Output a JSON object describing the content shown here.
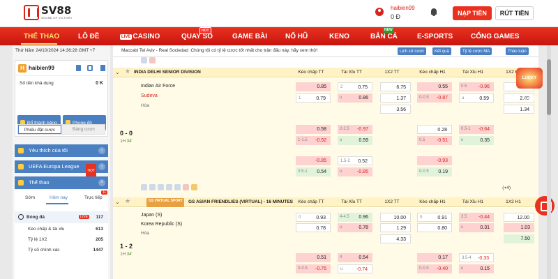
{
  "header": {
    "logo_name": "SV88",
    "logo_tagline": "SOUND OF VICTORY",
    "username": "haibien99",
    "balance": "0 Đ",
    "deposit_label": "NẠP TIỀN",
    "withdraw_label": "RÚT TIỀN"
  },
  "nav": {
    "items": [
      "THỂ THAO",
      "LÔ ĐỀ",
      "CASINO",
      "QUAY SỐ",
      "GAME BÀI",
      "NỔ HŨ",
      "KENO",
      "BẮN CÁ",
      "E-SPORTS",
      "CỔNG GAMES"
    ],
    "live_badge": "LIVE",
    "hot_badge": "HOT",
    "new_badge": "NEW"
  },
  "sidebar": {
    "datetime": "Thứ Năm 24/10/2024 14:36:28 GMT +7",
    "avatar_letter": "H",
    "username": "haibien99",
    "balance_label": "Số tiền khả dụng",
    "balance_value": "0 K",
    "btn_deposit": "Đổ thành bảng",
    "btn_promo": "Phong độ",
    "tab_active": "Phiếu đặt cược",
    "tab_other": "Bảng cược",
    "sections": [
      "Yêu thích của tôi",
      "UEFA Europa League",
      "Thể thao"
    ],
    "hot_badge": "HOT",
    "sub_tabs": [
      "Sớm",
      "Hôm nay",
      "Trực tiếp"
    ],
    "live_count": "11",
    "sport": {
      "name": "Bóng đá",
      "live": "LIVE",
      "count": "117"
    },
    "rows": [
      {
        "name": "Kèo chấp & tài xỉu",
        "count": "613"
      },
      {
        "name": "Tỷ lệ 1X2",
        "count": "205"
      },
      {
        "name": "Tỷ số chính xác",
        "count": "1447"
      }
    ]
  },
  "notice": {
    "text": "Maccabi Tel Aviv - Real Sociedad :Chúng tôi có tỷ lệ cược tốt nhất cho trận đấu này, hãy xem thử!",
    "btn_history": "Lịch sử cược",
    "btn_result": "Kết quả",
    "btn_odds": "Tỷ lệ cược MA",
    "btn_discuss": "Thảo luận"
  },
  "columns": [
    "Kèo chấp TT",
    "Tài Xỉu TT",
    "1X2 TT",
    "Kèo chấp H1",
    "Tài Xỉu H1",
    "1X2 H1"
  ],
  "league1": {
    "title": "INDIA DELHI SENIOR DIVISION",
    "score": "0 - 0",
    "time": "1H 34'",
    "home": "Indian Air Force",
    "away": "Sudeva",
    "draw": "Hòa",
    "more": "(+4)"
  },
  "league2": {
    "badge": "GS VIRTUAL SPORT",
    "title": "GS ASIAN FRIENDLIES (VIRTUAL) - 16 MINUTES",
    "score": "1 - 2",
    "time": "1H 34'",
    "home": "Japan (S)",
    "away": "Korea Republic (S)",
    "draw": "Hòa"
  },
  "odds_l1": {
    "r1": [
      [
        "",
        "0.85",
        "pk"
      ],
      [
        "2",
        "0.75",
        "wh"
      ],
      [
        "",
        "6.75",
        "wh"
      ],
      [
        "",
        "0.55",
        "pk"
      ],
      [
        "0.5",
        "-0.96",
        "pk"
      ],
      [
        "",
        "9.50",
        "wh"
      ]
    ],
    "r2": [
      [
        "1",
        "0.79",
        "wh"
      ],
      [
        "u",
        "0.86",
        "pk"
      ],
      [
        "",
        "1.37",
        "wh"
      ],
      [
        "0-0.5",
        "-0.87",
        "pk"
      ],
      [
        "u",
        "0.59",
        "wh"
      ],
      [
        "",
        "2.85",
        "wh"
      ]
    ],
    "r3": [
      [
        "",
        "",
        "none"
      ],
      [
        "",
        "",
        "none"
      ],
      [
        "",
        "3.56",
        "wh"
      ],
      [
        "",
        "",
        "none"
      ],
      [
        "",
        "",
        "none"
      ],
      [
        "",
        "1.34",
        "wh"
      ]
    ],
    "r4": [
      [
        "",
        "0.58",
        "pk"
      ],
      [
        "2-2.5",
        "-0.97",
        "pk"
      ],
      [
        "",
        "",
        "none"
      ],
      [
        "",
        "0.28",
        "wh"
      ],
      [
        "0.5-1",
        "-0.64",
        "pk"
      ],
      [
        "",
        "",
        "none"
      ]
    ],
    "r5": [
      [
        "1-1.5",
        "-0.92",
        "pk"
      ],
      [
        "u",
        "0.59",
        "gr"
      ],
      [
        "",
        "",
        "none"
      ],
      [
        "0.5",
        "-0.51",
        "pk"
      ],
      [
        "u",
        "0.35",
        "gr"
      ],
      [
        "",
        "",
        "none"
      ]
    ],
    "r6": [
      [
        "",
        "-0.85",
        "pk"
      ],
      [
        "1.5-2",
        "0.52",
        "wh"
      ],
      [
        "",
        "",
        "none"
      ],
      [
        "",
        "-0.93",
        "pk"
      ],
      [
        "",
        "",
        "none"
      ],
      [
        "",
        "",
        "none"
      ]
    ],
    "r7": [
      [
        "0.5-1",
        "0.54",
        "gr"
      ],
      [
        "u",
        "-0.85",
        "pk"
      ],
      [
        "",
        "",
        "none"
      ],
      [
        "0-0.5",
        "0.19",
        "gr"
      ],
      [
        "",
        "",
        "none"
      ],
      [
        "",
        "",
        "none"
      ]
    ]
  },
  "odds_l2": {
    "r1": [
      [
        "0",
        "0.93",
        "wh"
      ],
      [
        "4-4.5",
        "0.96",
        "gr"
      ],
      [
        "",
        "10.00",
        "wh"
      ],
      [
        "0",
        "0.91",
        "wh"
      ],
      [
        "3.5",
        "-0.44",
        "pk"
      ],
      [
        "",
        "12.00",
        "wh"
      ]
    ],
    "r2": [
      [
        "",
        "0.78",
        "wh"
      ],
      [
        "u",
        "0.78",
        "pk"
      ],
      [
        "",
        "1.29",
        "wh"
      ],
      [
        "",
        "0.80",
        "wh"
      ],
      [
        "u",
        "0.31",
        "pk"
      ],
      [
        "",
        "1.03",
        "pk"
      ]
    ],
    "r3": [
      [
        "",
        "",
        "none"
      ],
      [
        "",
        "",
        "none"
      ],
      [
        "",
        "4.33",
        "wh"
      ],
      [
        "",
        "",
        "none"
      ],
      [
        "",
        "",
        "none"
      ],
      [
        "",
        "7.50",
        "gr"
      ]
    ],
    "r4": [
      [
        "",
        "0.51",
        "pk"
      ],
      [
        "4",
        "0.54",
        "pk"
      ],
      [
        "",
        "",
        "none"
      ],
      [
        "",
        "0.17",
        "pk"
      ],
      [
        "3.5-4",
        "-0.33",
        "wh"
      ],
      [
        "",
        "",
        "none"
      ]
    ],
    "r5": [
      [
        "0-0.5",
        "-0.75",
        "pk"
      ],
      [
        "u",
        "-0.74",
        "wh"
      ],
      [
        "",
        "",
        "none"
      ],
      [
        "0-0.5",
        "-0.40",
        "pk"
      ],
      [
        "u",
        "0.15",
        "pk"
      ],
      [
        "",
        "",
        "none"
      ]
    ]
  },
  "gift_text": "LUCKY GAME"
}
